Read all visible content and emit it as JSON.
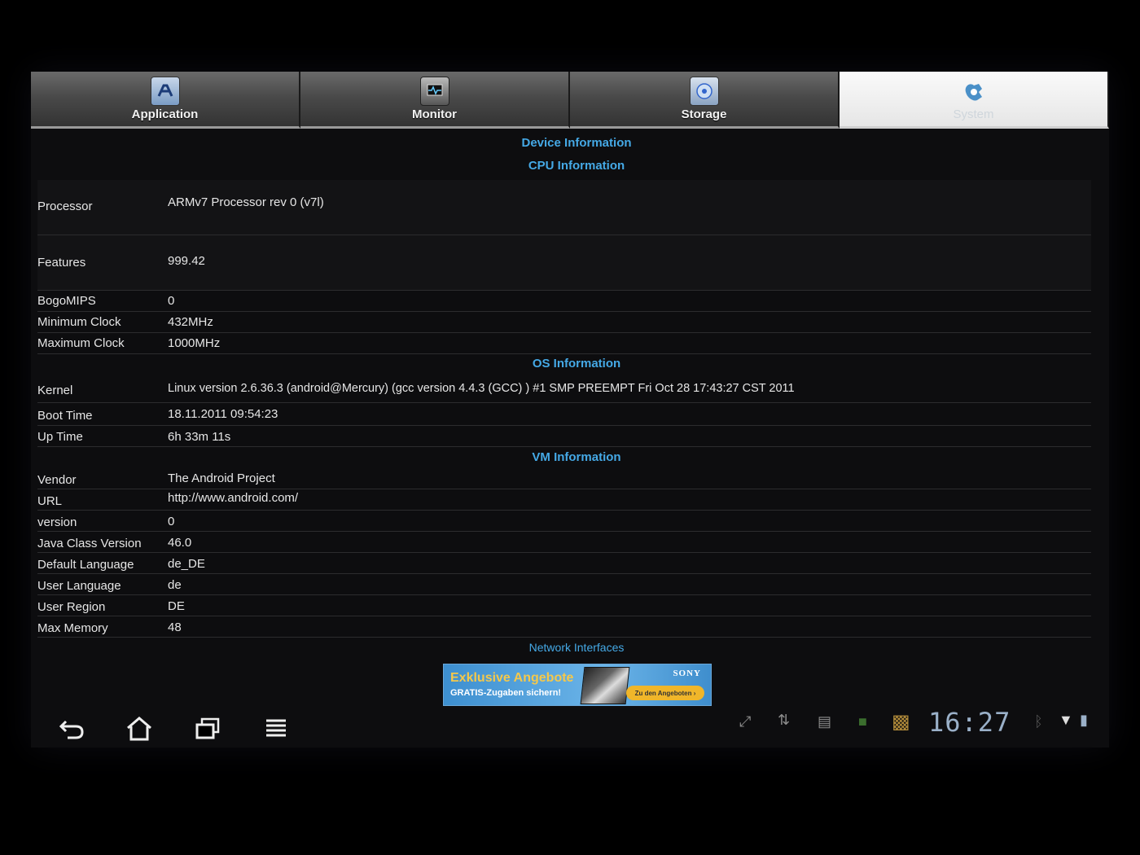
{
  "tabs": [
    {
      "label": "Application",
      "icon": "application-icon"
    },
    {
      "label": "Monitor",
      "icon": "monitor-icon"
    },
    {
      "label": "Storage",
      "icon": "storage-icon"
    },
    {
      "label": "System",
      "icon": "system-icon",
      "active": true
    }
  ],
  "sections": {
    "device": "Device Information",
    "cpu": "CPU Information",
    "os": "OS Information",
    "vm": "VM Information",
    "network": "Network Interfaces"
  },
  "cpu": [
    {
      "label": "Processor",
      "value": "ARMv7 Processor rev 0 (v7l)"
    },
    {
      "label": "Features",
      "value": "999.42"
    },
    {
      "label": "BogoMIPS",
      "value": "0"
    },
    {
      "label": "Minimum Clock",
      "value": "432MHz"
    },
    {
      "label": "Maximum Clock",
      "value": "1000MHz"
    }
  ],
  "os": [
    {
      "label": "Kernel",
      "value": "Linux version 2.6.36.3 (android@Mercury) (gcc version 4.4.3 (GCC) ) #1 SMP PREEMPT Fri Oct 28 17:43:27 CST 2011"
    },
    {
      "label": "Boot Time",
      "value": "18.11.2011 09:54:23"
    },
    {
      "label": "Up Time",
      "value": "6h 33m 11s"
    }
  ],
  "vm": [
    {
      "label": "Vendor",
      "value": "The Android Project"
    },
    {
      "label": "URL",
      "value": "http://www.android.com/"
    },
    {
      "label": "version",
      "value": "0"
    },
    {
      "label": "Java Class Version",
      "value": "46.0"
    },
    {
      "label": "Default Language",
      "value": "de_DE"
    },
    {
      "label": "User Language",
      "value": "de"
    },
    {
      "label": "User Region",
      "value": "DE"
    },
    {
      "label": "Max Memory",
      "value": "48"
    }
  ],
  "ad": {
    "title": "Exklusive Angebote",
    "subtitle": "GRATIS-Zugaben sichern!",
    "brand": "SONY",
    "cta": "Zu den Angeboten ›"
  },
  "statusbar": {
    "clock": "16:27"
  },
  "colors": {
    "accent": "#45a9e6",
    "background": "#0d0d0f",
    "active_tab": "#f2f2f2"
  }
}
